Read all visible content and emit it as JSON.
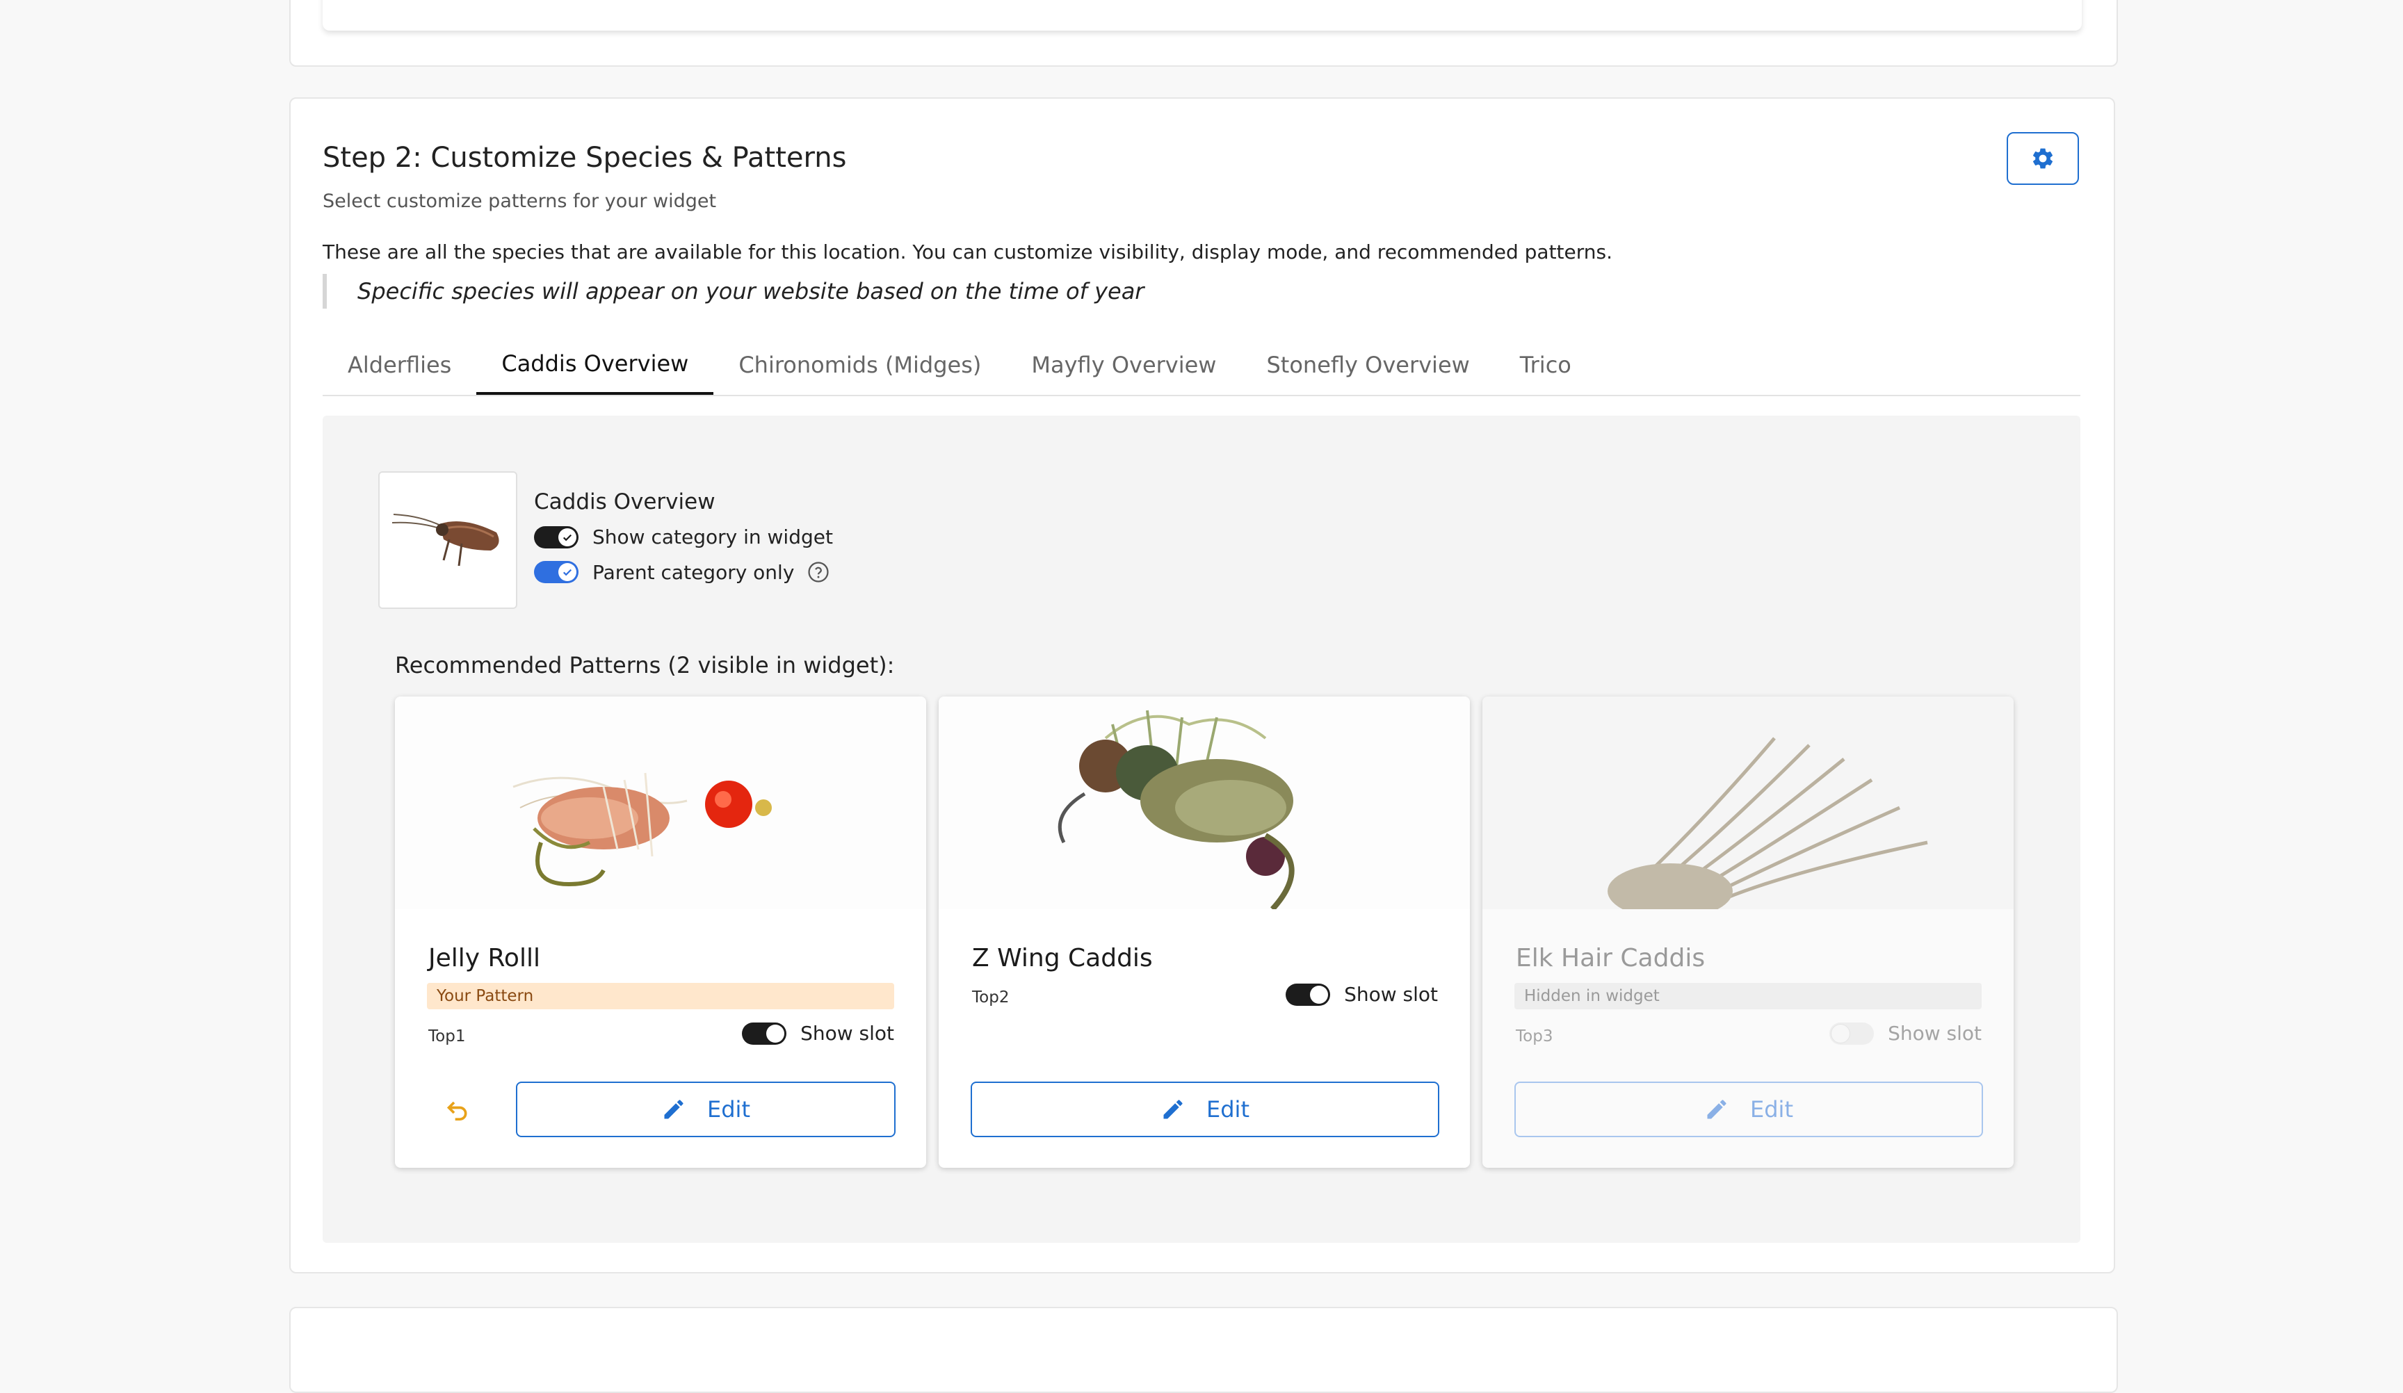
{
  "step": {
    "title": "Step 2: Customize Species & Patterns",
    "subtitle": "Select customize patterns for your widget",
    "description": "These are all the species that are available for this location. You can customize visibility, display mode, and recommended patterns.",
    "note": "Specific species will appear on your website based on the time of year",
    "settings_icon": "gear-icon"
  },
  "tabs": [
    {
      "label": "Alderflies",
      "active": false
    },
    {
      "label": "Caddis Overview",
      "active": true
    },
    {
      "label": "Chironomids (Midges)",
      "active": false
    },
    {
      "label": "Mayfly Overview",
      "active": false
    },
    {
      "label": "Stonefly Overview",
      "active": false
    },
    {
      "label": "Trico",
      "active": false
    }
  ],
  "category": {
    "name": "Caddis Overview",
    "show_in_widget_label": "Show category in widget",
    "show_in_widget": true,
    "parent_only_label": "Parent category only",
    "parent_only": true,
    "help_icon": "question-circle-icon"
  },
  "recommended": {
    "title": "Recommended Patterns (2 visible in widget):"
  },
  "patterns": [
    {
      "name": "Jelly Rolll",
      "badge": "Your Pattern",
      "slot": "Top1",
      "show_slot_label": "Show slot",
      "show_slot": true,
      "edit_label": "Edit",
      "undo_icon": "undo-icon",
      "edit_icon": "pencil-icon"
    },
    {
      "name": "Z Wing Caddis",
      "badge": "",
      "slot": "Top2",
      "show_slot_label": "Show slot",
      "show_slot": true,
      "edit_label": "Edit",
      "edit_icon": "pencil-icon"
    },
    {
      "name": "Elk Hair Caddis",
      "badge": "Hidden in widget",
      "slot": "Top3",
      "show_slot_label": "Show slot",
      "show_slot": false,
      "edit_label": "Edit",
      "edit_icon": "pencil-icon"
    }
  ],
  "colors": {
    "accent": "#1f6fd0",
    "toggle_on": "#1c1c1c",
    "toggle_blue": "#2f6fe0",
    "your_pattern_bg": "#ffe7cc",
    "undo": "#e8a21a"
  }
}
